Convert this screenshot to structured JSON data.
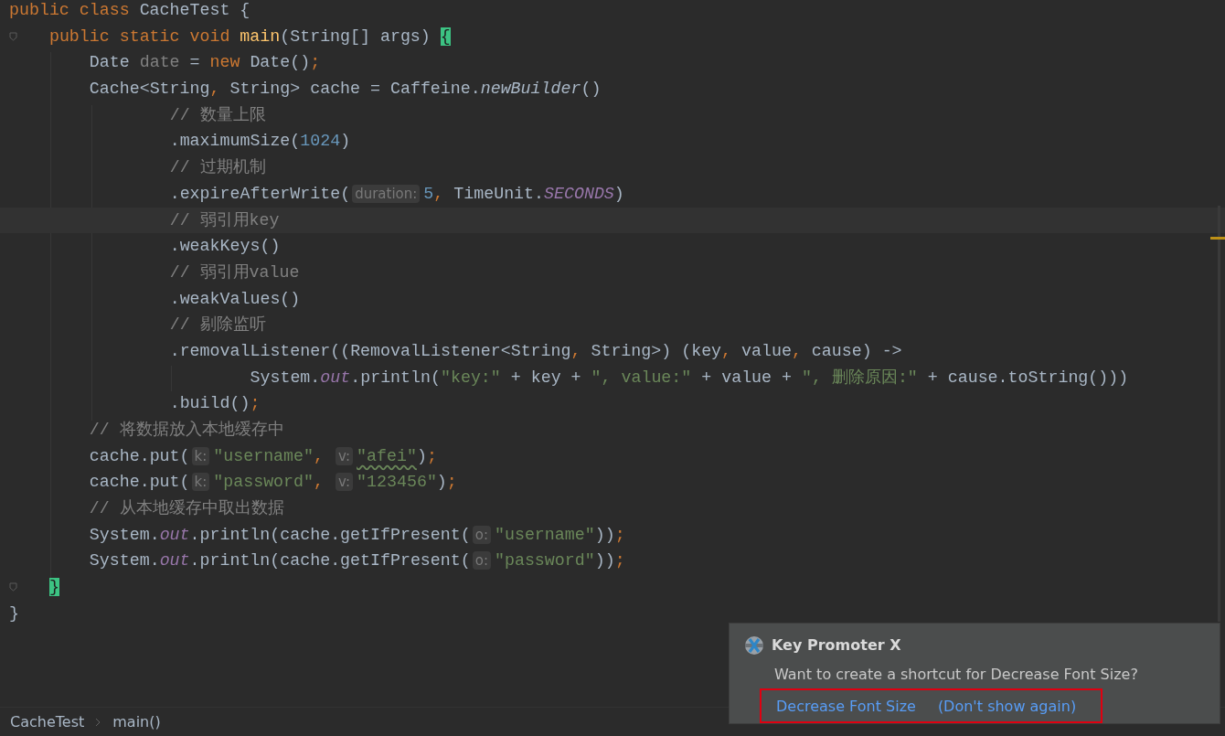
{
  "editor": {
    "lines": [
      {
        "current": false,
        "fold": false,
        "tokens": [
          {
            "kind": "kw",
            "text": "public class "
          },
          {
            "kind": "plain",
            "text": "CacheTest {"
          }
        ],
        "children": [
          {
            "current": false,
            "fold": true,
            "tokens": [
              {
                "kind": "kw",
                "text": "public static void "
              },
              {
                "kind": "method_decl",
                "text": "main"
              },
              {
                "kind": "plain",
                "text": "(String[] args) "
              },
              {
                "kind": "brace",
                "text": "{"
              }
            ],
            "children": [
              {
                "current": false,
                "fold": false,
                "tokens": [
                  {
                    "kind": "plain",
                    "text": "Date "
                  },
                  {
                    "kind": "unused",
                    "text": "date"
                  },
                  {
                    "kind": "plain",
                    "text": " = "
                  },
                  {
                    "kind": "kw",
                    "text": "new "
                  },
                  {
                    "kind": "plain",
                    "text": "Date()"
                  },
                  {
                    "kind": "kw",
                    "text": ";"
                  }
                ]
              },
              {
                "current": false,
                "fold": false,
                "tokens": [
                  {
                    "kind": "plain",
                    "text": "Cache<String"
                  },
                  {
                    "kind": "kw",
                    "text": ", "
                  },
                  {
                    "kind": "plain",
                    "text": "String> cache = Caffeine."
                  },
                  {
                    "kind": "static_call",
                    "text": "newBuilder"
                  },
                  {
                    "kind": "plain",
                    "text": "()"
                  }
                ],
                "children": [
                  {
                    "current": false,
                    "fold": false,
                    "tokens": [
                      {
                        "kind": "comment",
                        "text": "// 数量上限"
                      }
                    ]
                  },
                  {
                    "current": false,
                    "fold": false,
                    "tokens": [
                      {
                        "kind": "plain",
                        "text": ".maximumSize("
                      },
                      {
                        "kind": "number",
                        "text": "1024"
                      },
                      {
                        "kind": "plain",
                        "text": ")"
                      }
                    ]
                  },
                  {
                    "current": false,
                    "fold": false,
                    "tokens": [
                      {
                        "kind": "comment",
                        "text": "// 过期机制"
                      }
                    ]
                  },
                  {
                    "current": false,
                    "fold": false,
                    "tokens": [
                      {
                        "kind": "plain",
                        "text": ".expireAfterWrite("
                      },
                      {
                        "kind": "hint",
                        "text": "duration:"
                      },
                      {
                        "kind": "number",
                        "text": "5"
                      },
                      {
                        "kind": "kw",
                        "text": ", "
                      },
                      {
                        "kind": "plain",
                        "text": "TimeUnit."
                      },
                      {
                        "kind": "field",
                        "text": "SECONDS"
                      },
                      {
                        "kind": "plain",
                        "text": ")"
                      }
                    ]
                  },
                  {
                    "current": true,
                    "fold": false,
                    "tokens": [
                      {
                        "kind": "comment",
                        "text": "// 弱引用key"
                      }
                    ]
                  },
                  {
                    "current": false,
                    "fold": false,
                    "tokens": [
                      {
                        "kind": "plain",
                        "text": ".weakKeys()"
                      }
                    ]
                  },
                  {
                    "current": false,
                    "fold": false,
                    "tokens": [
                      {
                        "kind": "comment",
                        "text": "// 弱引用value"
                      }
                    ]
                  },
                  {
                    "current": false,
                    "fold": false,
                    "tokens": [
                      {
                        "kind": "plain",
                        "text": ".weakValues()"
                      }
                    ]
                  },
                  {
                    "current": false,
                    "fold": false,
                    "tokens": [
                      {
                        "kind": "comment",
                        "text": "// 剔除监听"
                      }
                    ]
                  },
                  {
                    "current": false,
                    "fold": false,
                    "tokens": [
                      {
                        "kind": "plain",
                        "text": ".removalListener((RemovalListener<String"
                      },
                      {
                        "kind": "kw",
                        "text": ", "
                      },
                      {
                        "kind": "plain",
                        "text": "String>) (key"
                      },
                      {
                        "kind": "kw",
                        "text": ", "
                      },
                      {
                        "kind": "plain",
                        "text": "value"
                      },
                      {
                        "kind": "kw",
                        "text": ", "
                      },
                      {
                        "kind": "plain",
                        "text": "cause) ->"
                      }
                    ],
                    "children": [
                      {
                        "current": false,
                        "fold": false,
                        "tokens": [
                          {
                            "kind": "plain",
                            "text": "System."
                          },
                          {
                            "kind": "field",
                            "text": "out"
                          },
                          {
                            "kind": "plain",
                            "text": ".println("
                          },
                          {
                            "kind": "string",
                            "text": "\"key:\""
                          },
                          {
                            "kind": "plain",
                            "text": " + key + "
                          },
                          {
                            "kind": "string",
                            "text": "\", value:\""
                          },
                          {
                            "kind": "plain",
                            "text": " + value + "
                          },
                          {
                            "kind": "string",
                            "text": "\", 删除原因:\""
                          },
                          {
                            "kind": "plain",
                            "text": " + cause.toString()))"
                          }
                        ]
                      }
                    ]
                  },
                  {
                    "current": false,
                    "fold": false,
                    "tokens": [
                      {
                        "kind": "plain",
                        "text": ".build()"
                      },
                      {
                        "kind": "kw",
                        "text": ";"
                      }
                    ]
                  }
                ]
              },
              {
                "current": false,
                "fold": false,
                "tokens": [
                  {
                    "kind": "comment",
                    "text": "// 将数据放入本地缓存中"
                  }
                ]
              },
              {
                "current": false,
                "fold": false,
                "tokens": [
                  {
                    "kind": "plain",
                    "text": "cache.put("
                  },
                  {
                    "kind": "hint",
                    "text": "k:"
                  },
                  {
                    "kind": "string",
                    "text": "\"username\""
                  },
                  {
                    "kind": "kw",
                    "text": ", "
                  },
                  {
                    "kind": "hint",
                    "text": "v:"
                  },
                  {
                    "kind": "typo_string",
                    "text": "\"afei\""
                  },
                  {
                    "kind": "plain",
                    "text": ")"
                  },
                  {
                    "kind": "kw",
                    "text": ";"
                  }
                ]
              },
              {
                "current": false,
                "fold": false,
                "tokens": [
                  {
                    "kind": "plain",
                    "text": "cache.put("
                  },
                  {
                    "kind": "hint",
                    "text": "k:"
                  },
                  {
                    "kind": "string",
                    "text": "\"password\""
                  },
                  {
                    "kind": "kw",
                    "text": ", "
                  },
                  {
                    "kind": "hint",
                    "text": "v:"
                  },
                  {
                    "kind": "string",
                    "text": "\"123456\""
                  },
                  {
                    "kind": "plain",
                    "text": ")"
                  },
                  {
                    "kind": "kw",
                    "text": ";"
                  }
                ]
              },
              {
                "current": false,
                "fold": false,
                "tokens": [
                  {
                    "kind": "comment",
                    "text": "// 从本地缓存中取出数据"
                  }
                ]
              },
              {
                "current": false,
                "fold": false,
                "tokens": [
                  {
                    "kind": "plain",
                    "text": "System."
                  },
                  {
                    "kind": "field",
                    "text": "out"
                  },
                  {
                    "kind": "plain",
                    "text": ".println(cache.getIfPresent("
                  },
                  {
                    "kind": "hint",
                    "text": "o:"
                  },
                  {
                    "kind": "string",
                    "text": "\"username\""
                  },
                  {
                    "kind": "plain",
                    "text": "))"
                  },
                  {
                    "kind": "kw",
                    "text": ";"
                  }
                ]
              },
              {
                "current": false,
                "fold": false,
                "tokens": [
                  {
                    "kind": "plain",
                    "text": "System."
                  },
                  {
                    "kind": "field",
                    "text": "out"
                  },
                  {
                    "kind": "plain",
                    "text": ".println(cache.getIfPresent("
                  },
                  {
                    "kind": "hint",
                    "text": "o:"
                  },
                  {
                    "kind": "string",
                    "text": "\"password\""
                  },
                  {
                    "kind": "plain",
                    "text": "))"
                  },
                  {
                    "kind": "kw",
                    "text": ";"
                  }
                ]
              }
            ]
          },
          {
            "current": false,
            "fold": true,
            "tokens": [
              {
                "kind": "brace",
                "text": "}"
              }
            ]
          }
        ]
      },
      {
        "current": false,
        "fold": false,
        "tokens": [
          {
            "kind": "plain",
            "text": "}"
          }
        ]
      }
    ]
  },
  "breadcrumbs": [
    {
      "text": "CacheTest"
    },
    {
      "text": "main()"
    }
  ],
  "notification": {
    "title": "Key Promoter X",
    "message": "Want to create a shortcut for Decrease Font Size?",
    "links": [
      "Decrease Font Size",
      "(Don't show again)"
    ],
    "links_outlined": true
  }
}
